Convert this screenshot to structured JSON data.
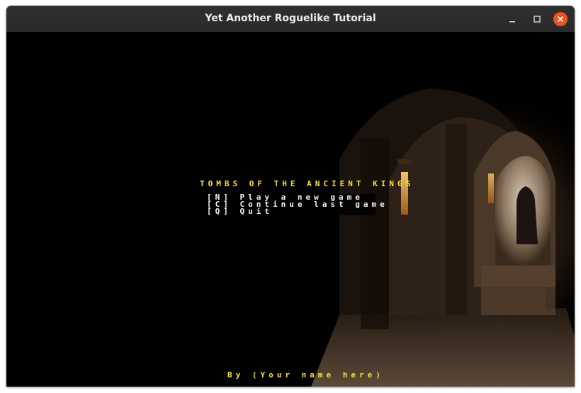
{
  "window": {
    "title": "Yet Another Roguelike Tutorial"
  },
  "controls": {
    "minimize_icon": "minimize-icon",
    "maximize_icon": "maximize-icon",
    "close_icon": "close-icon",
    "close_color": "#e95420"
  },
  "game": {
    "title": "TOMBS OF THE ANCIENT KINGS",
    "title_color": "#f5e33a",
    "menu": [
      {
        "label": "[N] Play a new game"
      },
      {
        "label": "[C] Continue last game"
      },
      {
        "label": "[Q] Quit"
      }
    ],
    "byline": "By (Your name here)",
    "background": "pixelated dungeon corridor with torches"
  }
}
